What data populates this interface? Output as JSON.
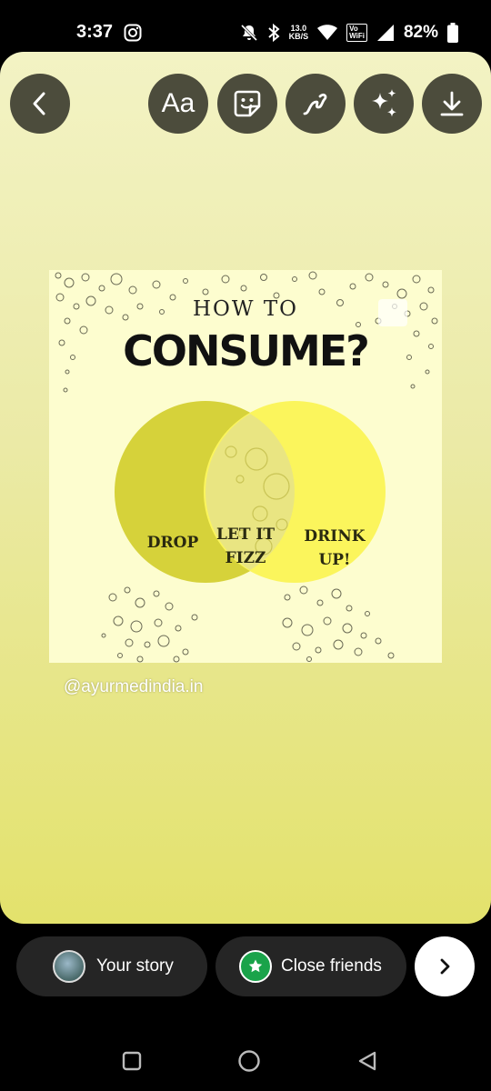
{
  "status_bar": {
    "time": "3:37",
    "net_speed_value": "13.0",
    "net_speed_unit": "KB/S",
    "volte_line1": "Vo",
    "volte_line2": "WiFi",
    "battery": "82%",
    "icons": [
      "instagram-icon",
      "mute-notification-icon",
      "bluetooth-icon",
      "wifi-icon",
      "cell-signal-icon",
      "battery-icon"
    ]
  },
  "toolbar": {
    "back_icon": "chevron-left-icon",
    "text_label": "Aa",
    "icons": [
      "sticker-icon",
      "draw-icon",
      "effects-icon",
      "download-icon"
    ]
  },
  "post": {
    "heading_small": "HOW TO",
    "heading_large": "CONSUME?",
    "venn_left": "DROP",
    "venn_middle_line1": "LET IT",
    "venn_middle_line2": "FIZZ",
    "venn_right_line1": "DRINK",
    "venn_right_line2": "UP!",
    "colors": {
      "left_circle": "#d6d23a",
      "right_circle": "#fbf55c",
      "background": "#fdfdcf"
    }
  },
  "handle": "@ayurmedindia.in",
  "share_bar": {
    "your_story": "Your story",
    "close_friends": "Close friends",
    "close_friends_color": "#1aa34a"
  },
  "navbar": {
    "icons": [
      "recents-square-icon",
      "home-circle-icon",
      "back-triangle-icon"
    ]
  }
}
